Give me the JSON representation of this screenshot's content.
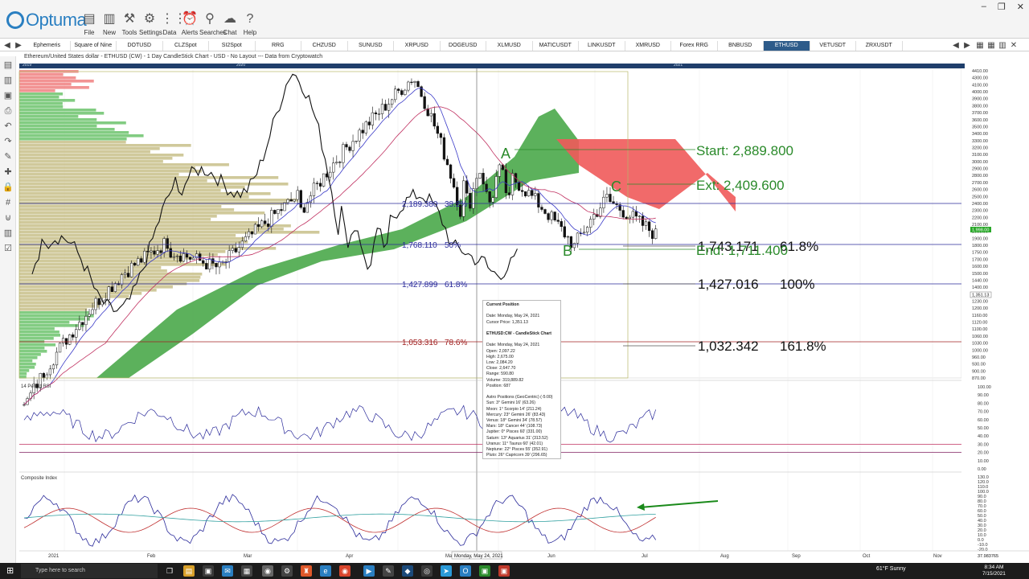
{
  "app": {
    "logo": "Optuma",
    "toolbar": [
      {
        "label": "File",
        "icon": "folder-icon",
        "glyph": "▤"
      },
      {
        "label": "New",
        "icon": "new-chart-icon",
        "glyph": "▥"
      },
      {
        "label": "Tools",
        "icon": "tools-icon",
        "glyph": "⚒"
      },
      {
        "label": "Settings",
        "icon": "gear-icon",
        "glyph": "⚙"
      },
      {
        "label": "Data",
        "icon": "data-icon",
        "glyph": "⋮⋮"
      },
      {
        "label": "Alerts",
        "icon": "alarm-clock-icon",
        "glyph": "⏰"
      },
      {
        "label": "Searches",
        "icon": "search-icon",
        "glyph": "⚲"
      },
      {
        "label": "Chat",
        "icon": "chat-icon",
        "glyph": "☁"
      },
      {
        "label": "Help",
        "icon": "help-icon",
        "glyph": "?"
      }
    ]
  },
  "tabs": [
    "Ephemeris",
    "Square of Nine",
    "DOTUSD",
    "CLZSpot",
    "SI2Spot",
    "RRG",
    "CHZUSD",
    "SUNUSD",
    "XRPUSD",
    "DOGEUSD",
    "XLMUSD",
    "MATICUSDT",
    "LINKUSDT",
    "XMRUSD",
    "Forex RRG",
    "BNBUSD",
    "ETHUSD",
    "VETUSDT",
    "ZRXUSDT"
  ],
  "active_tab": "ETHUSD",
  "chart_title": "Ethereum/United States dollar - ETHUSD (CW) - 1 Day CandleStick Chart - USD - No Layout --- Data from Cryptowatch",
  "time_strip": [
    "2019",
    "2020",
    "2021"
  ],
  "price_axis": {
    "labels": [
      "4410.00",
      "4300.00",
      "4100.00",
      "4000.00",
      "3900.00",
      "3800.00",
      "3700.00",
      "3600.00",
      "3500.00",
      "3400.00",
      "3300.00",
      "3200.00",
      "3100.00",
      "3000.00",
      "2900.00",
      "2800.00",
      "2700.00",
      "2600.00",
      "2500.00",
      "2400.00",
      "2300.00",
      "2200.00",
      "2100.00",
      "2000.00",
      "1900.00",
      "1800.00",
      "1750.00",
      "1700.00",
      "1600.00",
      "1500.00",
      "1440.00",
      "1400.00",
      "1300.00",
      "1230.00",
      "1200.00",
      "1160.00",
      "1120.00",
      "1100.00",
      "1060.00",
      "1030.00",
      "1000.00",
      "960.00",
      "930.00",
      "900.00",
      "870.00"
    ],
    "current_price": "1,998.00",
    "cursor_price": "1,351.13"
  },
  "fib_left": [
    {
      "price": "2,189.380",
      "pct": "38.2%"
    },
    {
      "price": "1,768.110",
      "pct": "50%"
    },
    {
      "price": "1,427.899",
      "pct": "61.8%"
    },
    {
      "price": "1,053.316",
      "pct": "78.6%"
    }
  ],
  "fib_right": [
    {
      "price": "1,743.171",
      "pct": "61.8%"
    },
    {
      "price": "1,427.016",
      "pct": "100%"
    },
    {
      "price": "1,032.342",
      "pct": "161.8%"
    }
  ],
  "projection": {
    "start": "Start: 2,889.800",
    "ext": "Ext: 2,409.600",
    "end": "End: 1,711.400"
  },
  "wave_labels": [
    "A",
    "B",
    "C"
  ],
  "rsi": {
    "title": "14 Period RSI",
    "labels": [
      "100.00",
      "90.00",
      "80.00",
      "70.00",
      "60.00",
      "50.00",
      "40.00",
      "30.00",
      "20.00",
      "10.00",
      "0.00"
    ]
  },
  "composite": {
    "title": "Composite Index",
    "labels": [
      "130.0",
      "120.0",
      "110.0",
      "100.0",
      "90.0",
      "80.0",
      "70.0",
      "60.0",
      "50.0",
      "40.0",
      "30.0",
      "20.0",
      "10.0",
      "0.0",
      "-10.0",
      "-20.0"
    ]
  },
  "date_axis": [
    "2021",
    "Feb",
    "Mar",
    "Apr",
    "May",
    "Jun",
    "Jul",
    "Aug",
    "Sep",
    "Oct",
    "Nov"
  ],
  "cursor_date": "Monday, May 24, 2021",
  "corner_value": "37.983765",
  "popup": {
    "lines": [
      {
        "t": "Current Position",
        "b": true
      },
      {
        "t": ""
      },
      {
        "t": "Date: Monday, May 24, 2021"
      },
      {
        "t": "Cursor Price: 1,351.13"
      },
      {
        "t": ""
      },
      {
        "t": "ETHUSD:CW - CandleStick Chart",
        "b": true
      },
      {
        "t": ""
      },
      {
        "t": "Date: Monday, May 24, 2021"
      },
      {
        "t": "Open: 2,097.22"
      },
      {
        "t": "High: 2,675.00"
      },
      {
        "t": "Low: 2,084.20"
      },
      {
        "t": "Close: 2,647.70"
      },
      {
        "t": "Range: 590.80"
      },
      {
        "t": "Volume: 319,889.82"
      },
      {
        "t": "Position: 687"
      },
      {
        "t": ""
      },
      {
        "t": "Astro Positions (GeoCentric) (-5:00)"
      },
      {
        "t": "Sun: 3° Gemini 16' (63.26)"
      },
      {
        "t": "Moon: 1° Scorpio 14' (211.24)"
      },
      {
        "t": "Mercury: 23° Gemini 26' (83.43)"
      },
      {
        "t": "Venus: 18° Gemini 34' (78.57)"
      },
      {
        "t": "Mars: 18° Cancer 44' (108.73)"
      },
      {
        "t": "Jupiter: 0° Pisces 60' (331.00)"
      },
      {
        "t": "Saturn: 13° Aquarius 31' (313.52)"
      },
      {
        "t": "Uranus: 11° Taurus 60' (42.01)"
      },
      {
        "t": "Neptune: 22° Pisces 55' (352.91)"
      },
      {
        "t": "Pluto: 26° Capricorn 39' (296.65)"
      }
    ]
  },
  "taskbar": {
    "search_placeholder": "Type here to search",
    "weather": "61°F  Sunny",
    "time": "8:34 AM",
    "date": "7/15/2021"
  },
  "colors": {
    "accent": "#2d5b8a",
    "fib_blue": "#2a2a9a",
    "fib_red": "#a02020",
    "cloud_green": "#3fa33f",
    "cloud_red": "#f05a5a",
    "label_green": "#2a8a2a"
  }
}
